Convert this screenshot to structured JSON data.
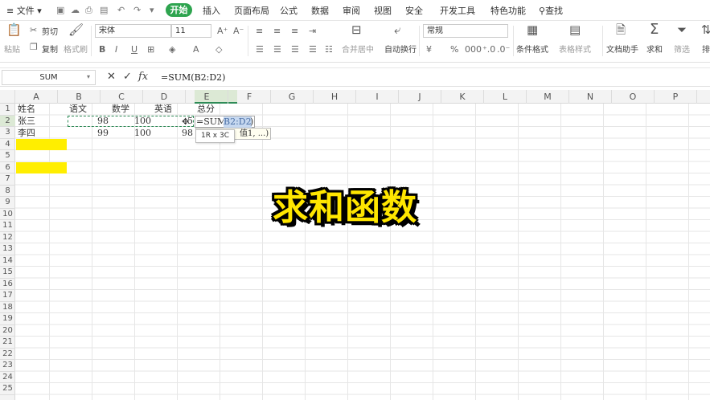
{
  "menubar": {
    "file": "文件",
    "tabs": [
      "开始",
      "插入",
      "页面布局",
      "公式",
      "数据",
      "审阅",
      "视图",
      "安全",
      "开发工具",
      "特色功能"
    ],
    "search": "查找"
  },
  "ribbon": {
    "paste": "粘贴",
    "cut": "剪切",
    "copy": "复制",
    "format_painter": "格式刷",
    "font_name": "宋体",
    "font_size": "11",
    "merge": "合并居中",
    "wrap": "自动换行",
    "number_format": "常规",
    "cond_format": "条件格式",
    "table_style": "表格样式",
    "doc_helper": "文档助手",
    "sum": "求和",
    "filter": "筛选",
    "sort": "排"
  },
  "formula_bar": {
    "name_box": "SUM",
    "formula": "=SUM(B2:D2)",
    "fx": "fx"
  },
  "columns": [
    "A",
    "B",
    "C",
    "D",
    "E",
    "F",
    "G",
    "H",
    "I",
    "J",
    "K",
    "L",
    "M",
    "N",
    "O",
    "P"
  ],
  "rows": [
    "1",
    "2",
    "3",
    "4",
    "5",
    "6",
    "7",
    "8",
    "9",
    "10",
    "11",
    "12",
    "13",
    "14",
    "15",
    "16",
    "17",
    "18",
    "19",
    "20",
    "21",
    "22",
    "23",
    "24",
    "25"
  ],
  "sheet": {
    "headers": [
      "姓名",
      "语文",
      "数学",
      "英语",
      "总分"
    ],
    "row2": [
      "张三",
      "98",
      "100",
      "5"
    ],
    "row3": [
      "李四",
      "99",
      "100",
      "98"
    ],
    "edit_prefix": "=SUM(",
    "edit_ref": "B2:D2",
    "edit_suffix": ")",
    "hint": "值1, ...)",
    "tooltip": "1R x 3C"
  },
  "overlay_title": "求和函数",
  "colors": {
    "accent": "#2ea44f",
    "highlight": "#ffee00",
    "overlay": "#ffe600"
  }
}
